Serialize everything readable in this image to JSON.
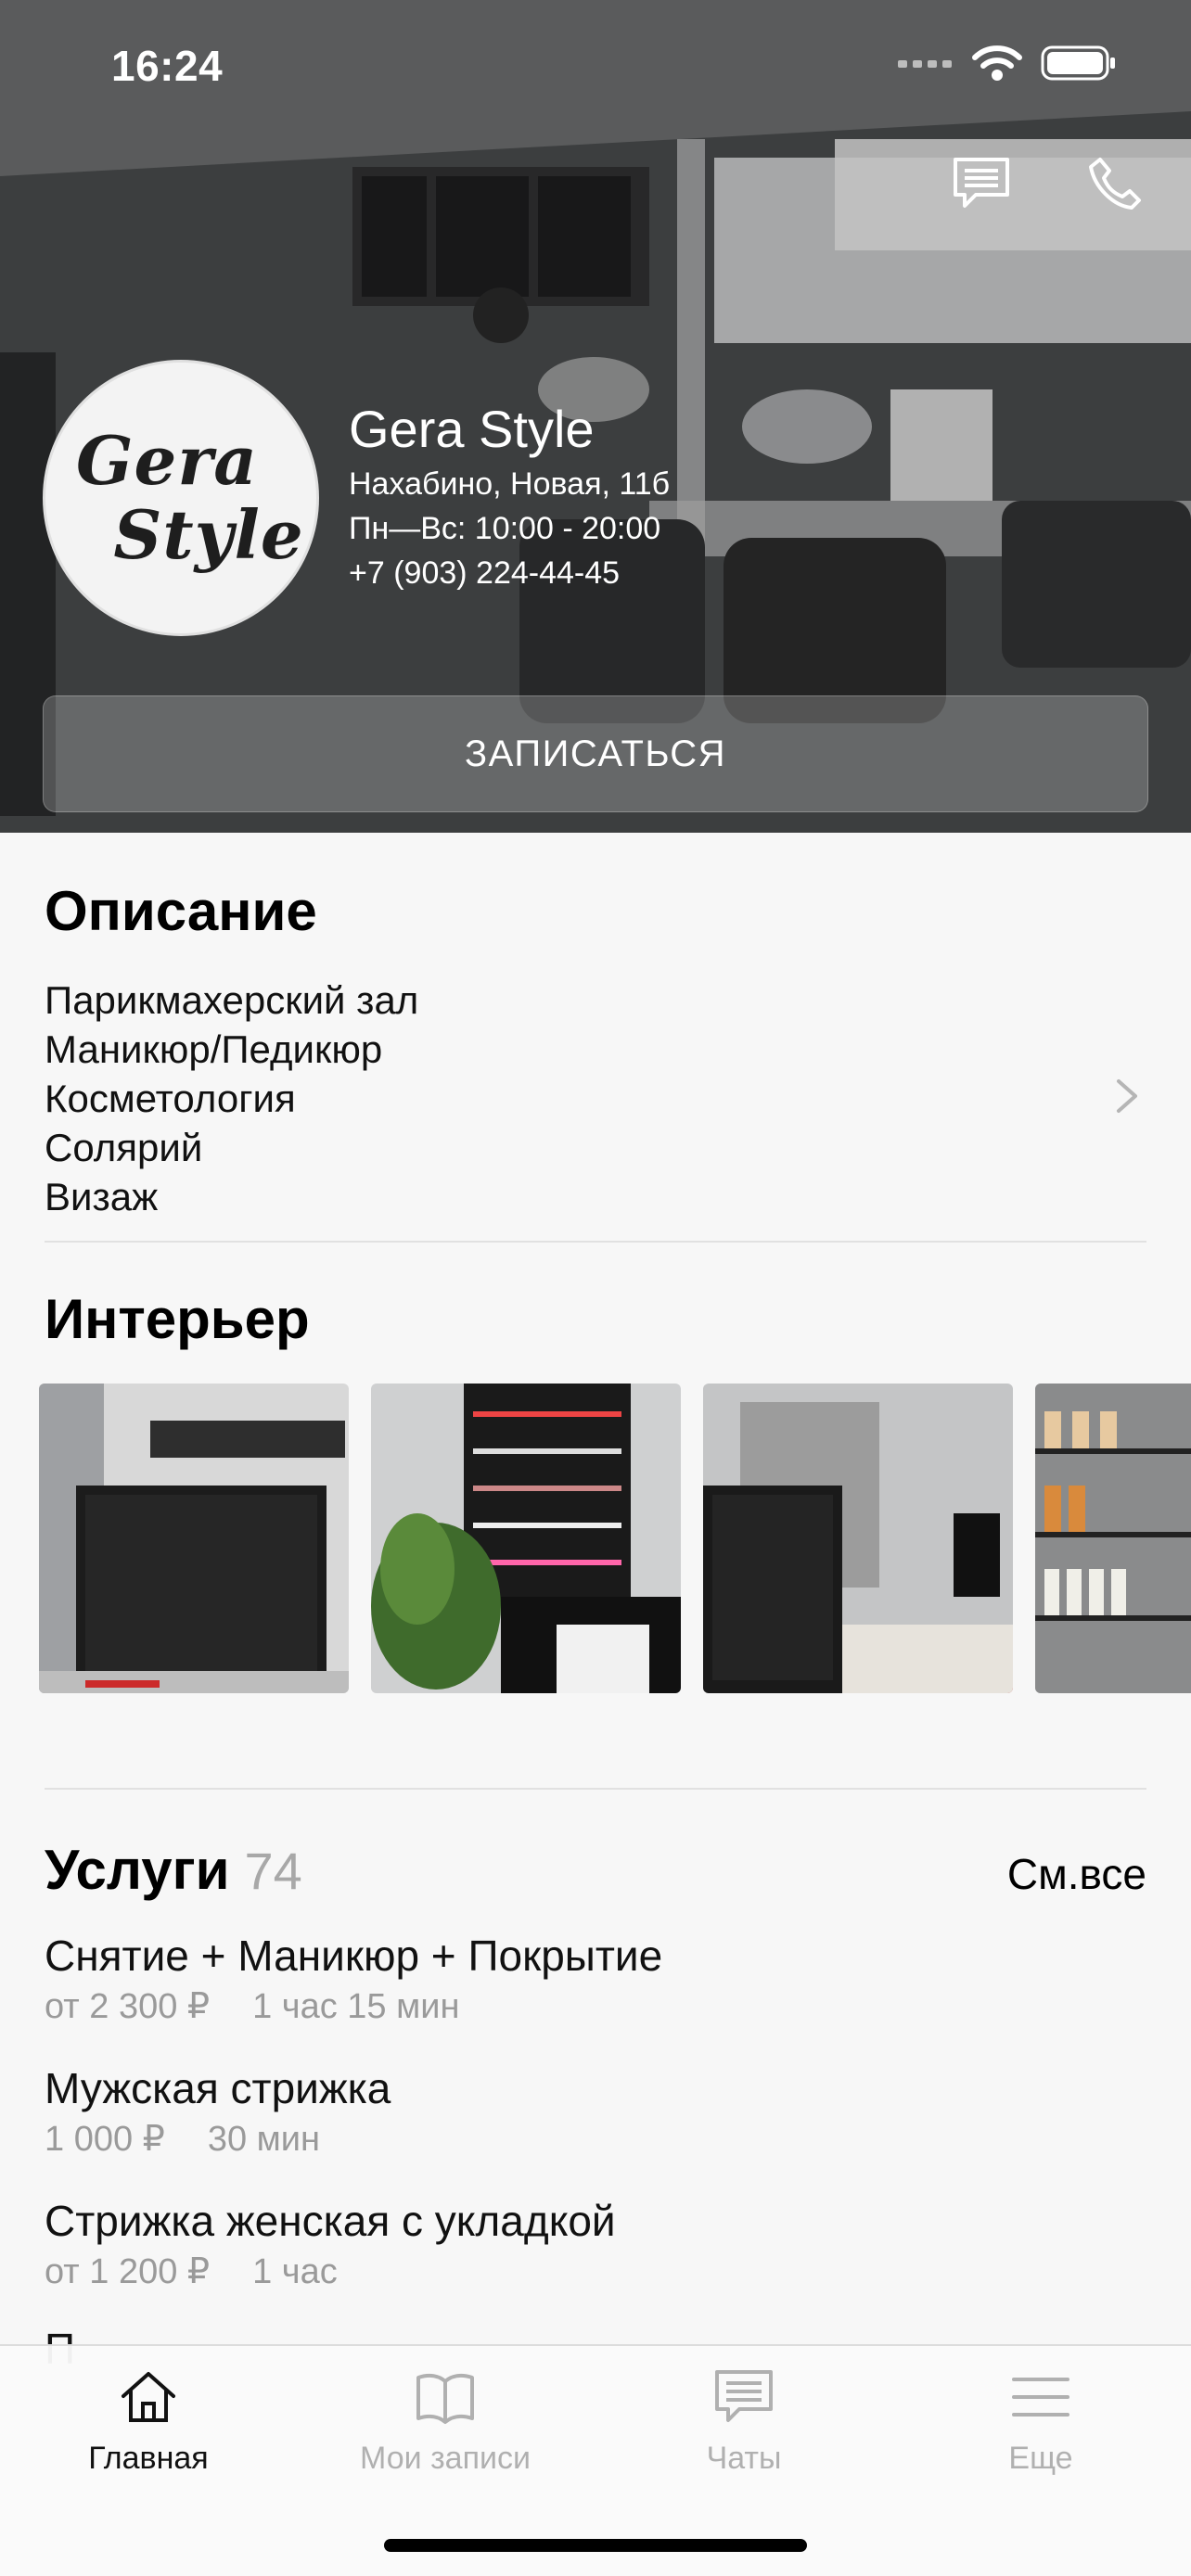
{
  "status_bar": {
    "time": "16:24"
  },
  "hero": {
    "logo_text_line1": "Gera",
    "logo_text_line2": "Style",
    "name": "Gera Style",
    "address": "Нахабино, Новая, 11б",
    "hours": "Пн—Вс: 10:00 - 20:00",
    "phone": "+7 (903) 224-44-45",
    "book_button": "ЗАПИСАТЬСЯ"
  },
  "description": {
    "title": "Описание",
    "items": [
      "Парикмахерский зал",
      "Маникюр/Педикюр",
      "Косметология",
      "Солярий",
      "Визаж"
    ]
  },
  "interior": {
    "title": "Интерьер"
  },
  "services": {
    "title": "Услуги",
    "count": "74",
    "see_all": "См.все",
    "items": [
      {
        "name": "Снятие + Маникюр + Покрытие",
        "price": "от 2 300 ₽",
        "duration": "1 час 15 мин"
      },
      {
        "name": "Мужская стрижка",
        "price": "1 000 ₽",
        "duration": "30 мин"
      },
      {
        "name": "Стрижка женская с укладкой",
        "price": "от 1 200 ₽",
        "duration": "1 час"
      }
    ],
    "cut_off_text": "П"
  },
  "tabbar": {
    "tabs": [
      {
        "label": "Главная",
        "icon": "home-icon",
        "active": true
      },
      {
        "label": "Мои записи",
        "icon": "book-icon",
        "active": false
      },
      {
        "label": "Чаты",
        "icon": "chat-icon",
        "active": false
      },
      {
        "label": "Еще",
        "icon": "menu-icon",
        "active": false
      }
    ]
  },
  "colors": {
    "accent_text": "#000000",
    "muted_text": "#9a9a9a",
    "background": "#f7f7f7"
  }
}
